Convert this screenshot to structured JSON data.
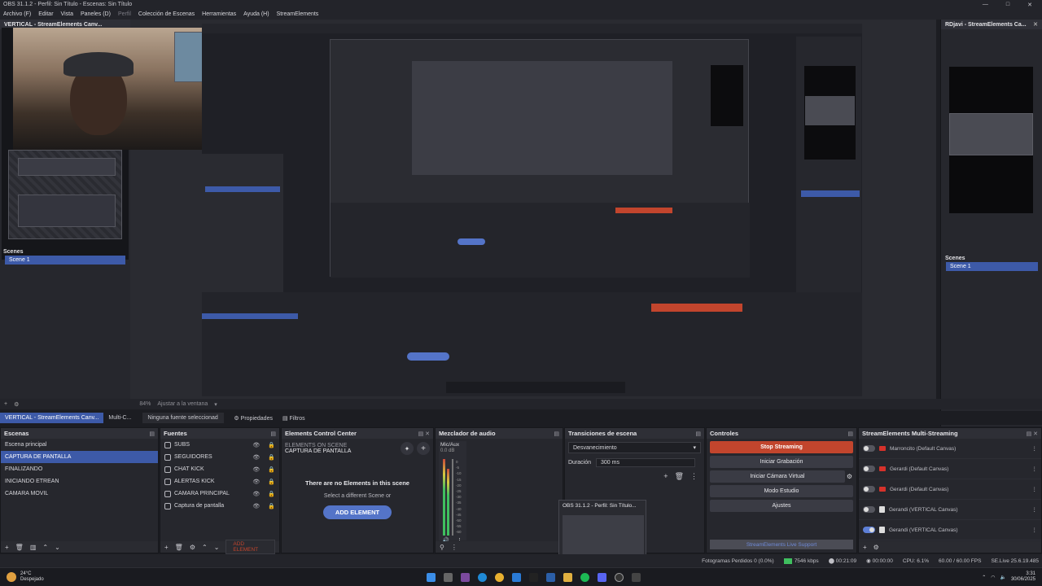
{
  "window": {
    "title": "OBS 31.1.2 - Perfil: Sin Título - Escenas: Sin Título",
    "minimize": "—",
    "maximize": "□",
    "close": "✕"
  },
  "menu": [
    "Archivo (F)",
    "Editar",
    "Vista",
    "Paneles (D)",
    "Perfil",
    "Colección de Escenas",
    "Herramientas",
    "Ayuda (H)",
    "StreamElements"
  ],
  "vertical_dock": {
    "title": "VERTICAL - StreamElements Canv...",
    "scenes_label": "Scenes",
    "scene": "Scene 1"
  },
  "rdjavi_dock": {
    "title": "RDjavi - StreamElements Ca...",
    "scenes_label": "Scenes",
    "scene": "Scene 1"
  },
  "context_bar": {
    "zoom": "84%",
    "fit": "Ajustar a la ventana"
  },
  "tabs": {
    "vertical": "VERTICAL - StreamElements Canv...",
    "multi": "Multi-C...",
    "no_source": "Ninguna fuente seleccionad",
    "properties": "Propiedades",
    "filters": "Filtros"
  },
  "scenes_panel": {
    "title": "Escenas",
    "items": [
      "Escena principal",
      "CAPTURA DE PANTALLA",
      "FINALIZANDO",
      "INICIANDO ETREAN",
      "CAMARA MOVIL"
    ],
    "selected_index": 1
  },
  "sources_panel": {
    "title": "Fuentes",
    "items": [
      "SUBS",
      "SEGUIDORES",
      "CHAT KICK",
      "ALERTAS KICK",
      "CAMARA PRINCIPAL",
      "Captura de pantalla"
    ]
  },
  "ecc_panel": {
    "title": "Elements Control Center",
    "elements_on_scene": "ELEMENTS ON SCENE",
    "scene_name": "CAPTURA DE PANTALLA",
    "empty_title": "There are no Elements in this scene",
    "empty_sub": "Select a different Scene or",
    "add_button": "ADD ELEMENT",
    "footer_add": "ADD ELEMENT"
  },
  "audio_panel": {
    "title": "Mezclador de audio",
    "channel": "Mic/Aux",
    "db": "0.0 dB",
    "scale": [
      "0",
      "-5",
      "-10",
      "-15",
      "-20",
      "-25",
      "-30",
      "-35",
      "-40",
      "-45",
      "-50",
      "-55",
      "-60"
    ]
  },
  "transitions_panel": {
    "title": "Transiciones de escena",
    "transition": "Desvanecimiento",
    "duration_label": "Duración",
    "duration_value": "300 ms"
  },
  "controls_panel": {
    "title": "Controles",
    "buttons": [
      "Stop Streaming",
      "Iniciar Grabación",
      "Iniciar Cámara Virtual",
      "Modo Estudio",
      "Ajustes"
    ],
    "support": "StreamElements Live Support"
  },
  "multistream_panel": {
    "title": "StreamElements Multi-Streaming",
    "rows": [
      {
        "name": "Marroncito (Default Canvas)",
        "on": false
      },
      {
        "name": "Gerardi (Default Canvas)",
        "on": false
      },
      {
        "name": "Gerardi (Default Canvas)",
        "on": false
      },
      {
        "name": "Gerandi (VERTICAL Canvas)",
        "on": false
      },
      {
        "name": "Gerandi (VERTICAL Canvas)",
        "on": true
      }
    ]
  },
  "tooltip": {
    "text": "OBS 31.1.2 - Perfil: Sin Título..."
  },
  "status": {
    "dropped": "Fotogramas Perdidos 0 (0.0%)",
    "bitrate": "7546 kbps",
    "live_time": "00:21:09",
    "rec_time": "00:00:00",
    "cpu": "CPU: 6.1%",
    "fps": "60.00 / 60.00 FPS",
    "se": "SE.Live 25.6.19.485"
  },
  "taskbar": {
    "temp": "24°C",
    "weather": "Despejado",
    "time": "3:31",
    "date": "30/06/2025"
  },
  "colors": {
    "accent": "#3d5aa8",
    "stop": "#c2452d",
    "youtube": "#d6322b"
  }
}
